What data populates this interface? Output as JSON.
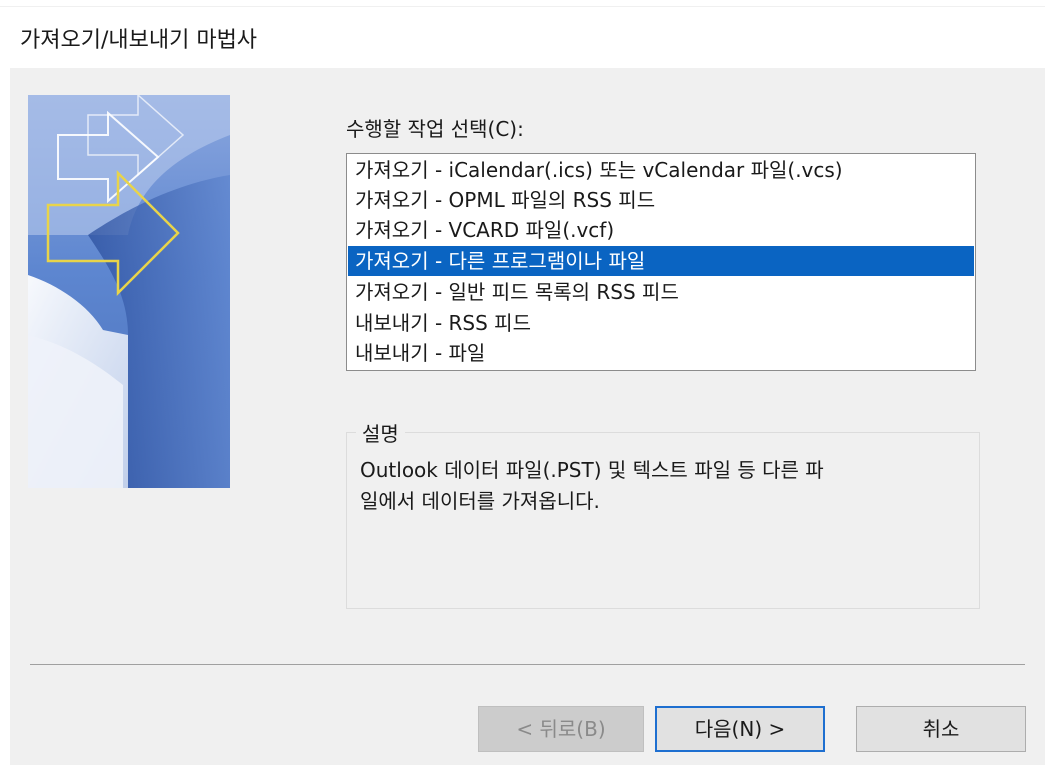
{
  "window": {
    "title": "가져오기/내보내기 마법사"
  },
  "task": {
    "label": "수행할 작업 선택(C):",
    "items": [
      "가져오기 - iCalendar(.ics) 또는 vCalendar 파일(.vcs)",
      "가져오기 - OPML 파일의 RSS 피드",
      "가져오기 - VCARD 파일(.vcf)",
      "가져오기 - 다른 프로그램이나 파일",
      "가져오기 - 일반 피드 목록의 RSS 피드",
      "내보내기 - RSS 피드",
      "내보내기 - 파일"
    ],
    "selected": "가져오기 - 다른 프로그램이나 파일"
  },
  "description": {
    "title": "설명",
    "text": "Outlook 데이터 파일(.PST) 및 텍스트 파일 등 다른 파\n일에서 데이터를 가져옵니다."
  },
  "buttons": {
    "back": "< 뒤로(B)",
    "next": "다음(N) >",
    "cancel": "취소"
  },
  "colors": {
    "selection": "#0a64c2",
    "dialog_background": "#f0f0f0",
    "default_button_border": "#1e6fd0"
  }
}
